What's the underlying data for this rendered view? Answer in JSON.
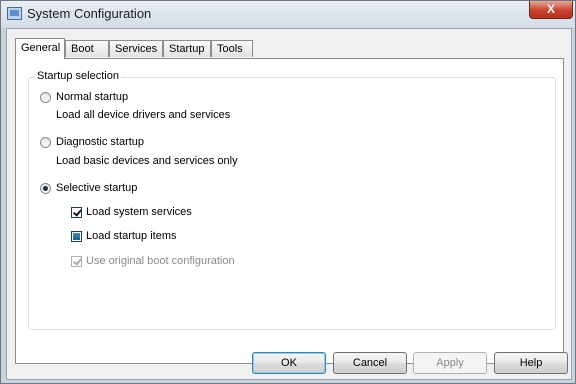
{
  "window": {
    "title": "System Configuration",
    "close_glyph": "X"
  },
  "tabs": [
    {
      "label": "General"
    },
    {
      "label": "Boot"
    },
    {
      "label": "Services"
    },
    {
      "label": "Startup"
    },
    {
      "label": "Tools"
    }
  ],
  "active_tab": "General",
  "startup_selection": {
    "group_label": "Startup selection",
    "normal": {
      "label": "Normal startup",
      "description": "Load all device drivers and services",
      "selected": false
    },
    "diagnostic": {
      "label": "Diagnostic startup",
      "description": "Load basic devices and services only",
      "selected": false
    },
    "selective": {
      "label": "Selective startup",
      "selected": true,
      "options": {
        "system_services": {
          "label": "Load system services",
          "state": "checked"
        },
        "startup_items": {
          "label": "Load startup items",
          "state": "indeterminate"
        },
        "original_boot": {
          "label": "Use original boot configuration",
          "state": "checked-disabled"
        }
      }
    }
  },
  "buttons": {
    "ok": "OK",
    "cancel": "Cancel",
    "apply": "Apply",
    "help": "Help"
  },
  "icons": {
    "app": "system-config-icon",
    "close": "close-icon"
  },
  "colors": {
    "close_button": "#c7432f",
    "default_button_border": "#3c7fb1"
  }
}
